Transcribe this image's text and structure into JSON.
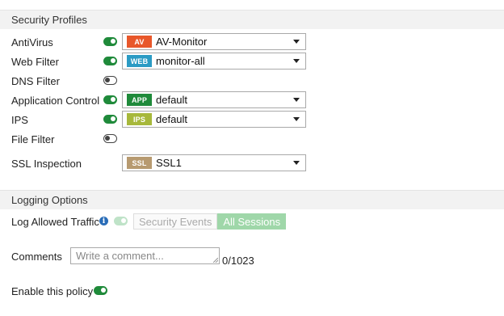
{
  "security_profiles": {
    "header": "Security Profiles",
    "rows": [
      {
        "label": "AntiVirus",
        "enabled": true,
        "badge": "AV",
        "badge_color": "#e8572a",
        "value": "AV-Monitor"
      },
      {
        "label": "Web Filter",
        "enabled": true,
        "badge": "WEB",
        "badge_color": "#2b9bc4",
        "value": "monitor-all"
      },
      {
        "label": "DNS Filter",
        "enabled": false
      },
      {
        "label": "Application Control",
        "enabled": true,
        "badge": "APP",
        "badge_color": "#1f8a3a",
        "value": "default"
      },
      {
        "label": "IPS",
        "enabled": true,
        "badge": "IPS",
        "badge_color": "#a7b83b",
        "value": "default"
      },
      {
        "label": "File Filter",
        "enabled": false
      }
    ],
    "ssl": {
      "label": "SSL Inspection",
      "badge": "SSL",
      "badge_color": "#b79a70",
      "value": "SSL1"
    }
  },
  "logging": {
    "header": "Logging Options",
    "log_allowed_traffic": {
      "label": "Log Allowed Traffic",
      "enabled": true,
      "options": [
        "Security Events",
        "All Sessions"
      ],
      "selected": "All Sessions"
    }
  },
  "comments": {
    "label": "Comments",
    "placeholder": "Write a comment...",
    "counter": "0/1023"
  },
  "policy": {
    "enable_label": "Enable this policy",
    "enabled": true
  },
  "colors": {
    "toggle_on": "#1f8a3a",
    "segment_active": "#9fd7a9"
  }
}
